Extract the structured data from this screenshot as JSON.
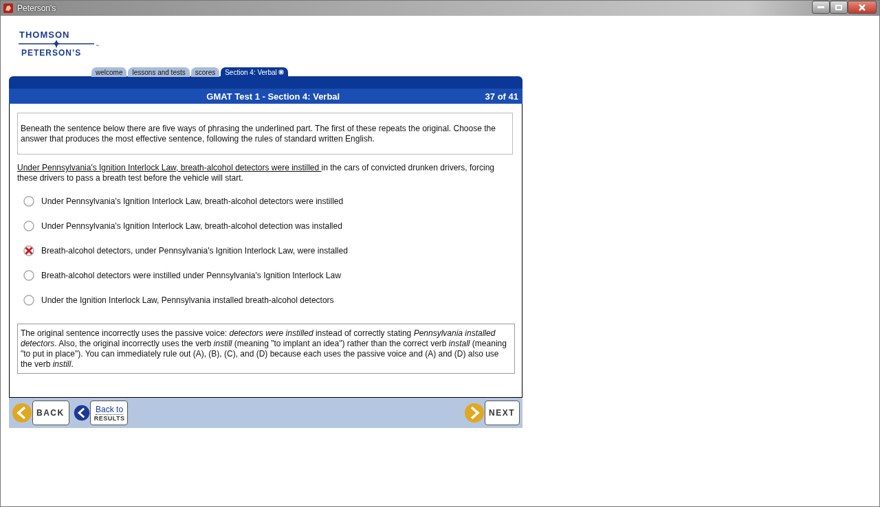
{
  "window": {
    "title": "Peterson's"
  },
  "logo": {
    "top": "THOMSON",
    "bottom": "PETERSON’S",
    "mark": "™"
  },
  "tabs": [
    {
      "label": "welcome",
      "selected": false
    },
    {
      "label": "lessons and tests",
      "selected": false
    },
    {
      "label": "scores",
      "selected": false
    },
    {
      "label": "Section 4: Verbal",
      "selected": true,
      "closable": true
    }
  ],
  "header": {
    "title": "GMAT Test 1 - Section 4: Verbal",
    "counter": "37 of 41"
  },
  "instructions": "Beneath the sentence below there are five ways of phrasing the underlined part. The first of these repeats the original. Choose the answer that produces the most effective sentence, following the rules of standard written English.",
  "stem": {
    "underlined": "Under Pennsylvania's Ignition Interlock Law, breath-alcohol detectors were instilled ",
    "rest": "in the cars of convicted drunken drivers, forcing these drivers to pass a breath test before the vehicle will start."
  },
  "choices": [
    {
      "text": "Under Pennsylvania's Ignition Interlock Law, breath-alcohol detectors were instilled",
      "selected": false
    },
    {
      "text": "Under Pennsylvania's Ignition Interlock Law, breath-alcohol detection was installed",
      "selected": false
    },
    {
      "text": "Breath-alcohol detectors, under Pennsylvania's Ignition Interlock Law, were installed",
      "selected": true
    },
    {
      "text": "Breath-alcohol detectors were instilled under Pennsylvania's Ignition Interlock Law",
      "selected": false
    },
    {
      "text": "Under the Ignition Interlock Law, Pennsylvania installed breath-alcohol detectors",
      "selected": false
    }
  ],
  "explanation": "The original sentence incorrectly uses the passive voice: *detectors were instilled* instead of correctly stating *Pennsylvania installed detectors*. Also, the original incorrectly uses the verb *instill* (meaning \"to implant an idea\") rather than the correct verb *install* (meaning \"to put in place\"). You can immediately rule out (A), (B), (C), and (D) because each uses the passive voice and (A) and (D) also use the verb *instill*.",
  "footer": {
    "back": "BACK",
    "results_top": "Back to",
    "results_bottom": "RESULTS",
    "next": "NEXT"
  }
}
